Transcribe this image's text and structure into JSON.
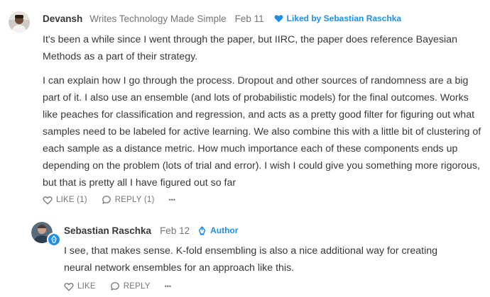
{
  "comment": {
    "author": "Devansh",
    "subtitle": "Writes Technology Made Simple",
    "date": "Feb 11",
    "liked_by": "Liked by Sebastian Raschka",
    "paragraphs": [
      "It's been a while since I went through the paper, but IIRC, the paper does reference Bayesian Methods as a part of their strategy.",
      "I can explain how I go through the process. Dropout and other sources of randomness are a big part of it. I also use an ensemble (and lots of probabilistic models) for the final outcomes. Works like peaches for classification and regression, and acts as a pretty good filter for figuring out what samples need to be labeled for active learning. We also combine this with a little bit of clustering of each sample as a distance metric. How much importance each of these components ends up depending on the problem (lots of trial and error). I wish I could give you something more rigorous, but that is pretty all I have figured out so far"
    ],
    "like_label": "LIKE (1)",
    "reply_label": "REPLY (1)",
    "more_label": "•••"
  },
  "reply": {
    "author": "Sebastian Raschka",
    "date": "Feb 12",
    "author_badge": "Author",
    "text": "I see, that makes sense. K-fold ensembling is also a nice additional way for creating neural network ensembles for an approach like this.",
    "like_label": "LIKE",
    "reply_label": "REPLY",
    "more_label": "•••"
  },
  "colors": {
    "accent": "#1f8ee8",
    "text": "#363737",
    "muted": "#757575"
  },
  "icons": {
    "heart": "heart-icon",
    "speech": "speech-bubble-icon",
    "pen": "pen-nib-icon"
  }
}
